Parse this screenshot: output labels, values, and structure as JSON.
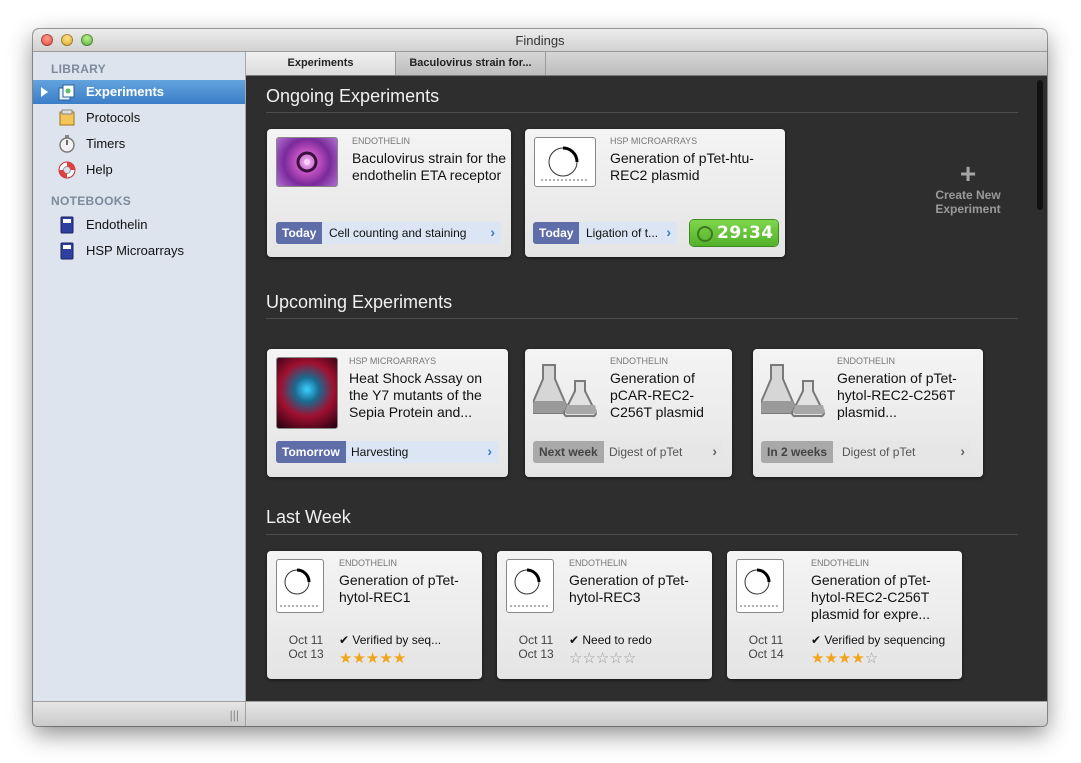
{
  "window": {
    "title": "Findings"
  },
  "sidebar": {
    "library_heading": "LIBRARY",
    "notebooks_heading": "NOTEBOOKS",
    "library_items": [
      {
        "label": "Experiments",
        "icon": "experiments-icon",
        "selected": true
      },
      {
        "label": "Protocols",
        "icon": "protocols-icon"
      },
      {
        "label": "Timers",
        "icon": "stopwatch-icon"
      },
      {
        "label": "Help",
        "icon": "lifebuoy-icon"
      }
    ],
    "notebooks": [
      {
        "label": "Endothelin",
        "icon": "notebook-icon"
      },
      {
        "label": "HSP Microarrays",
        "icon": "notebook-icon"
      }
    ],
    "footer_grip": "|||"
  },
  "tabs": [
    {
      "label": "Experiments",
      "active": true
    },
    {
      "label": "Baculovirus strain for..."
    }
  ],
  "ongoing": {
    "heading": "Ongoing Experiments",
    "cards": [
      {
        "category": "ENDOTHELIN",
        "title": "Baculovirus strain for the endothelin ETA receptor",
        "step_when": "Today",
        "step_what": "Cell counting and staining"
      },
      {
        "category": "HSP MICROARRAYS",
        "title": "Generation of pTet-htu-REC2 plasmid",
        "step_when": "Today",
        "step_what": "Ligation of t...",
        "timer": "29:34"
      }
    ],
    "create": "Create New Experiment",
    "create_icon": "plus-icon"
  },
  "upcoming": {
    "heading": "Upcoming Experiments",
    "cards": [
      {
        "category": "HSP MICROARRAYS",
        "title": "Heat Shock Assay on the Y7 mutants of the Sepia Protein and...",
        "step_when": "Tomorrow",
        "step_what": "Harvesting"
      },
      {
        "category": "ENDOTHELIN",
        "title": "Generation of pCAR-REC2-C256T plasmid",
        "step_when": "Next week",
        "step_what": "Digest of pTet"
      },
      {
        "category": "ENDOTHELIN",
        "title": "Generation of pTet-hytol-REC2-C256T plasmid...",
        "step_when": "In 2 weeks",
        "step_what": "Digest of pTet"
      }
    ]
  },
  "last_week": {
    "heading": "Last Week",
    "cards": [
      {
        "category": "ENDOTHELIN",
        "title": "Generation of pTet-hytol-REC1",
        "date_start": "Oct 11",
        "date_end": "Oct 13",
        "status": "✔ Verified by seq...",
        "rating": 5
      },
      {
        "category": "ENDOTHELIN",
        "title": "Generation of pTet-hytol-REC3",
        "date_start": "Oct 11",
        "date_end": "Oct 13",
        "status": "✔ Need to redo",
        "rating": 0
      },
      {
        "category": "ENDOTHELIN",
        "title": "Generation of pTet-hytol-REC2-C256T plasmid for expre...",
        "date_start": "Oct 11",
        "date_end": "Oct 14",
        "status": "✔ Verified by sequencing",
        "rating": 4
      }
    ]
  },
  "colors": {
    "selection": "#3a7ec8",
    "step_when": "#5f6ea8",
    "timer": "#52b12a",
    "star": "#f2a51a"
  }
}
